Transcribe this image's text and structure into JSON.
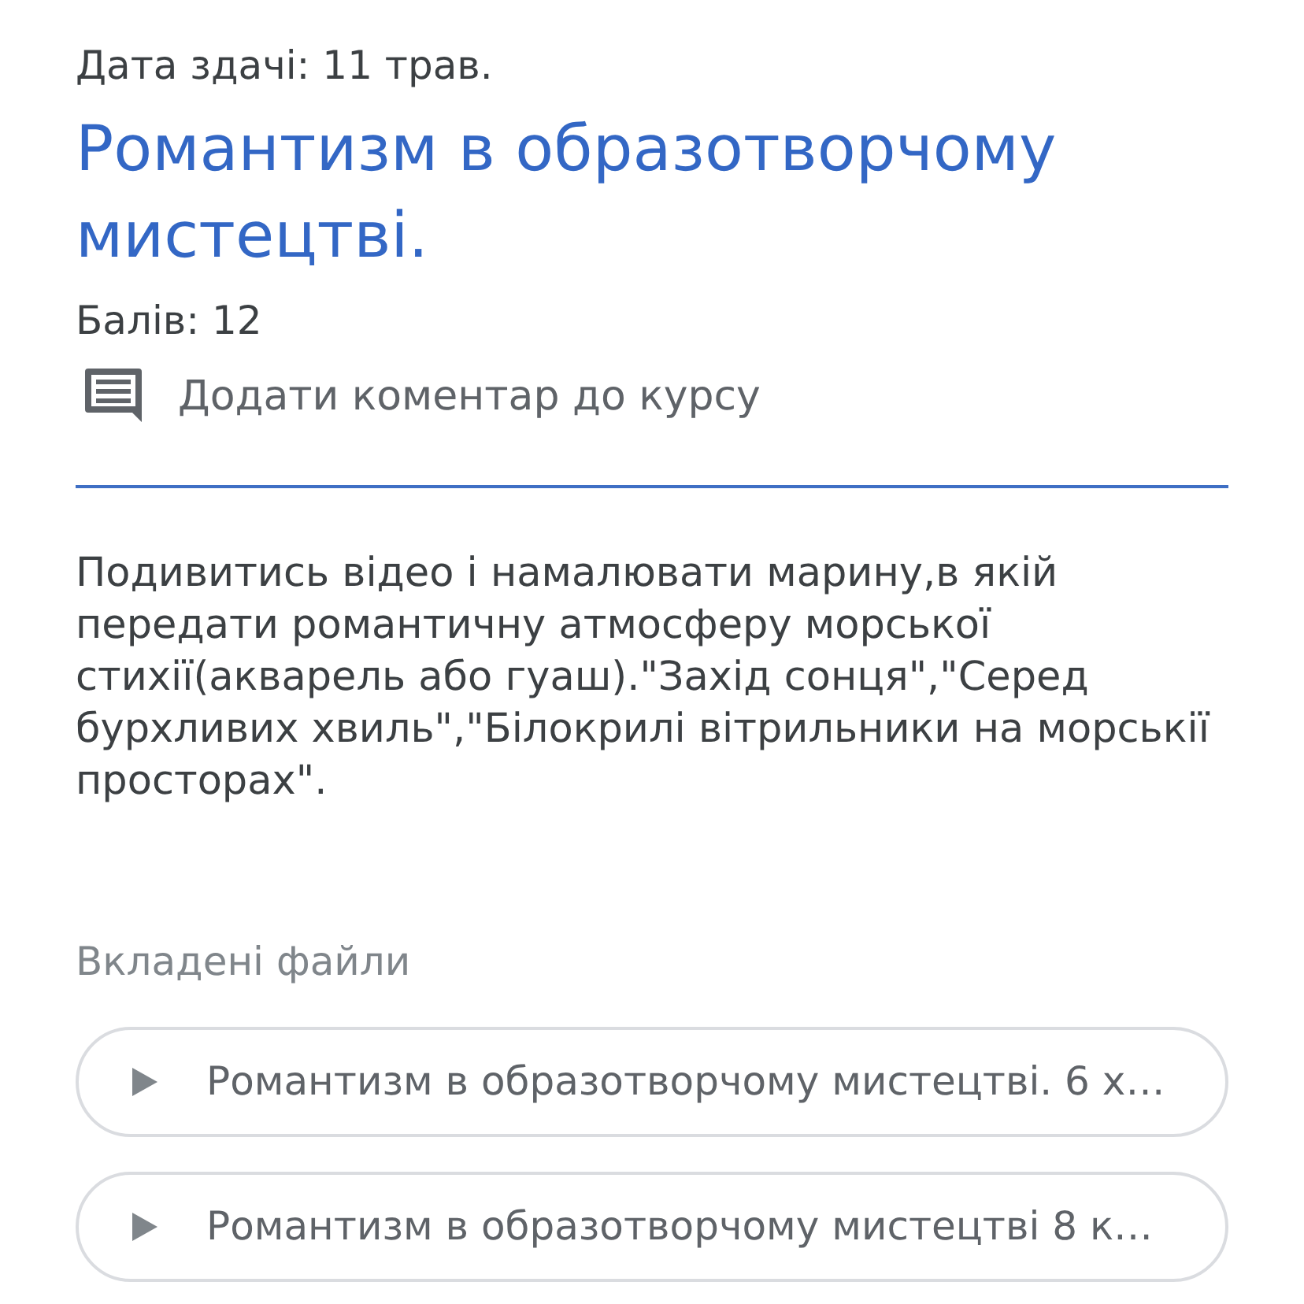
{
  "due_date": "Дата здачі: 11 трав.",
  "title": "Романтизм в образотворчому мистецтві.",
  "points": "Балів: 12",
  "comment_link": "Додати коментар до курсу",
  "description": "Подивитись відео і намалювати марину,в якій передати романтичну атмосферу морської стихії(акварель або гуаш).\"Захід сонця\",\"Серед бурхливих хвиль\",\"Білокрилі вітрильники на морськії просторах\".",
  "attachments": {
    "heading": "Вкладені файли",
    "files": [
      {
        "name": "Романтизм в образотворчому мистецтві. 6 х…"
      },
      {
        "name": "Романтизм в образотворчому мистецтві 8 к…"
      }
    ]
  }
}
